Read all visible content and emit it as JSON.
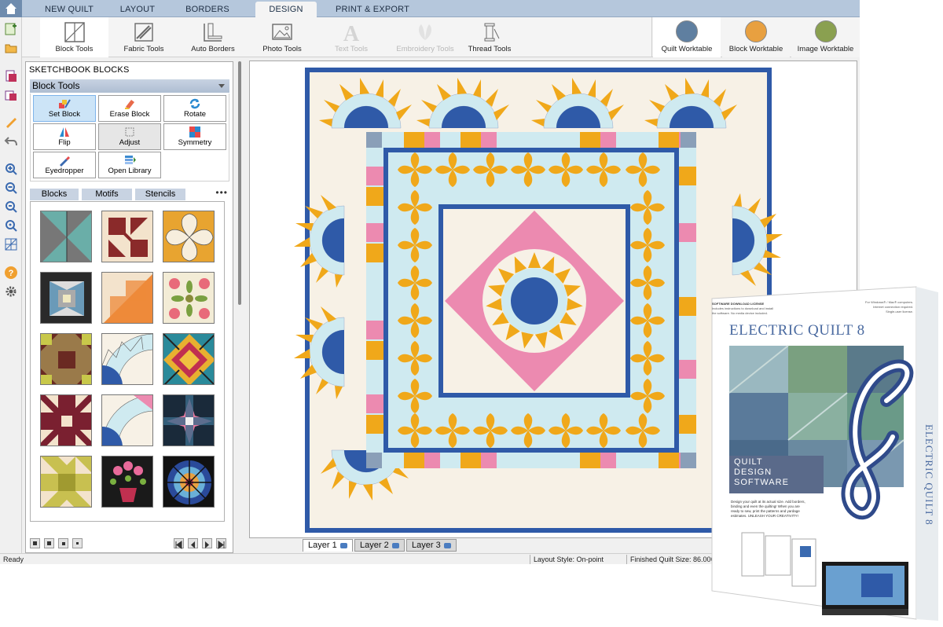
{
  "tabs": [
    {
      "label": "NEW QUILT",
      "active": false
    },
    {
      "label": "LAYOUT",
      "active": false
    },
    {
      "label": "BORDERS",
      "active": false
    },
    {
      "label": "DESIGN",
      "active": true
    },
    {
      "label": "PRINT & EXPORT",
      "active": false
    }
  ],
  "ribbon": {
    "tools": [
      {
        "label": "Block Tools",
        "icon": "block-tools-icon",
        "selected": true,
        "disabled": false
      },
      {
        "label": "Fabric Tools",
        "icon": "fabric-tools-icon",
        "selected": false,
        "disabled": false
      },
      {
        "label": "Auto Borders",
        "icon": "auto-borders-icon",
        "selected": false,
        "disabled": false
      },
      {
        "label": "Photo Tools",
        "icon": "photo-tools-icon",
        "selected": false,
        "disabled": false
      },
      {
        "label": "Text Tools",
        "icon": "text-tools-icon",
        "selected": false,
        "disabled": true
      },
      {
        "label": "Embroidery Tools",
        "icon": "embroidery-tools-icon",
        "selected": false,
        "disabled": true
      },
      {
        "label": "Thread Tools",
        "icon": "thread-tools-icon",
        "selected": false,
        "disabled": false
      }
    ],
    "worktables": [
      {
        "label": "Quilt Worktable",
        "selected": true,
        "color": "#5f7fa0"
      },
      {
        "label": "Block Worktable",
        "selected": false,
        "color": "#e8a040"
      },
      {
        "label": "Image Worktable",
        "selected": false,
        "color": "#8aa050"
      }
    ]
  },
  "left_toolbar": [
    "add-sketchbook-icon",
    "open-file-icon",
    "save-icon",
    "print-icon",
    "pencil-icon",
    "undo-icon",
    "zoom-in-icon",
    "zoom-out-icon",
    "zoom-fit-icon",
    "zoom-box-icon",
    "grid-icon",
    "help-icon",
    "settings-icon"
  ],
  "panel": {
    "title": "SKETCHBOOK BLOCKS",
    "tools_header": "Block Tools",
    "tools": [
      {
        "label": "Set Block",
        "icon": "set-block-icon",
        "selected": true
      },
      {
        "label": "Erase Block",
        "icon": "erase-block-icon",
        "selected": false
      },
      {
        "label": "Rotate",
        "icon": "rotate-icon",
        "selected": false
      },
      {
        "label": "Flip",
        "icon": "flip-icon",
        "selected": false
      },
      {
        "label": "Adjust",
        "icon": "adjust-icon",
        "selected": false
      },
      {
        "label": "Symmetry",
        "icon": "symmetry-icon",
        "selected": false
      },
      {
        "label": "Eyedropper",
        "icon": "eyedropper-icon",
        "selected": false
      },
      {
        "label": "Open Library",
        "icon": "open-library-icon",
        "selected": false
      }
    ],
    "content_tabs": [
      "Blocks",
      "Motifs",
      "Stencils"
    ],
    "more": "•••",
    "selected_block": 6
  },
  "layers": [
    {
      "label": "Layer 1",
      "active": true
    },
    {
      "label": "Layer 2",
      "active": false
    },
    {
      "label": "Layer 3",
      "active": false
    }
  ],
  "status": {
    "left": "Ready",
    "layout": "Layout Style: On-point",
    "size": "Finished Quilt Size: 86.000"
  },
  "box": {
    "license_title": "SOFTWARE DOWNLOAD LICENSE",
    "license_l1": "Includes instructions to download and install",
    "license_l2": "the software. No media device included.",
    "req_l1": "For Windows® / Mac® computers.",
    "req_l2": "Internet connection required.",
    "req_l3": "Single-user license.",
    "title": "ELECTRIC QUILT 8",
    "version": "8",
    "sub_l1": "QUILT",
    "sub_l2": "DESIGN",
    "sub_l3": "SOFTWARE",
    "desc_l1": "Design your quilt at its actual size. Add borders,",
    "desc_l2": "binding and even the quilting! When you are",
    "desc_l3": "ready to sew, print the patterns and yardage",
    "desc_l4": "estimates. UNLEASH YOUR CREATIVITY!",
    "spine": "ELECTRIC QUILT 8"
  },
  "colors": {
    "blue": "#2f5aa8",
    "gold": "#f0a81a",
    "pink": "#ec8ab0",
    "light_blue": "#cfeaf0",
    "cream": "#f7f1e6"
  }
}
